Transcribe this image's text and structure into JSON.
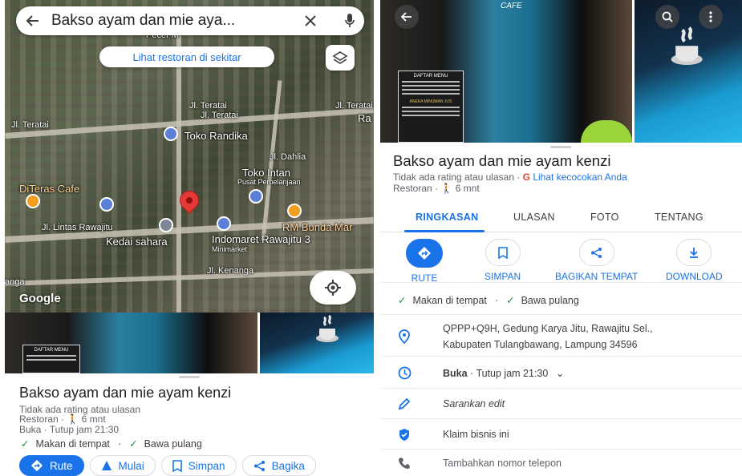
{
  "left_screen": {
    "search": {
      "query": "Bakso ayam dan mie aya...",
      "back_icon": "arrow-left-icon",
      "clear_icon": "close-icon",
      "mic_icon": "mic-icon"
    },
    "nearby_chip": "Lihat restoran di sekitar",
    "map": {
      "logo": "Google",
      "labels": {
        "pecerm": "Pecer M",
        "teratai1": "Jl. Teratai",
        "teratai2": "Jl. Teratai",
        "teratai3": "Jl. Teratai",
        "teratai4": "Jl. Teratai",
        "ra": "Ra",
        "toko_randika": "Toko Randika",
        "dahlia": "Jl. Dahlia",
        "toko_intan": "Toko Intan",
        "pusat": "Pusat Perbelanjaan",
        "diteras": "DiTeras Cafe",
        "lintas": "Jl. Lintas Rawajitu",
        "kedai": "Kedai sahara",
        "indomaret": "Indomaret Rawajitu 3",
        "minimarket": "Minimarket",
        "rm_bunda": "RM Bunda Mar",
        "kenanga1": "Jl. Kenanga",
        "kenanga2": "anga"
      }
    },
    "photo_menu_title": "DAFTAR MENU",
    "place": {
      "name": "Bakso ayam dan mie ayam kenzi",
      "rating": "Tidak ada rating atau ulasan",
      "category_line": "Restoran · ",
      "walk": "6 mnt",
      "hours_line": "Buka · Tutup jam 21:30",
      "service1": "Makan di tempat",
      "sep": "·",
      "service2": "Bawa pulang"
    },
    "actions": {
      "route": "Rute",
      "start": "Mulai",
      "save": "Simpan",
      "share": "Bagika"
    }
  },
  "right_screen": {
    "photo_menu_title": "DAFTAR MENU",
    "photo_menu_sub": "ANEKA MINUMAN JUS",
    "photo_sign": "CAFE",
    "place": {
      "name": "Bakso ayam dan mie ayam kenzi",
      "rating": "Tidak ada rating atau ulasan · ",
      "match_link": "Lihat kecocokan Anda",
      "category_line": "Restoran · ",
      "walk": "6 mnt"
    },
    "tabs": [
      "RINGKASAN",
      "ULASAN",
      "FOTO",
      "TENTANG"
    ],
    "actions": {
      "route": "RUTE",
      "save": "SIMPAN",
      "share": "BAGIKAN TEMPAT",
      "download": "DOWNLOAD"
    },
    "services": {
      "s1": "Makan di tempat",
      "sep": "·",
      "s2": "Bawa pulang"
    },
    "address_line1": "QPPP+Q9H, Gedung Karya Jitu, Rawajitu Sel.,",
    "address_line2": "Kabupaten Tulangbawang, Lampung 34596",
    "hours_open": "Buka",
    "hours_rest": " · Tutup jam 21:30",
    "suggest_edit": "Sarankan edit",
    "claim": "Klaim bisnis ini",
    "add_phone": "Tambahkan nomor telepon"
  },
  "colors": {
    "accent": "#1a73e8",
    "pin": "#e53935",
    "check": "#1e8e3e"
  }
}
